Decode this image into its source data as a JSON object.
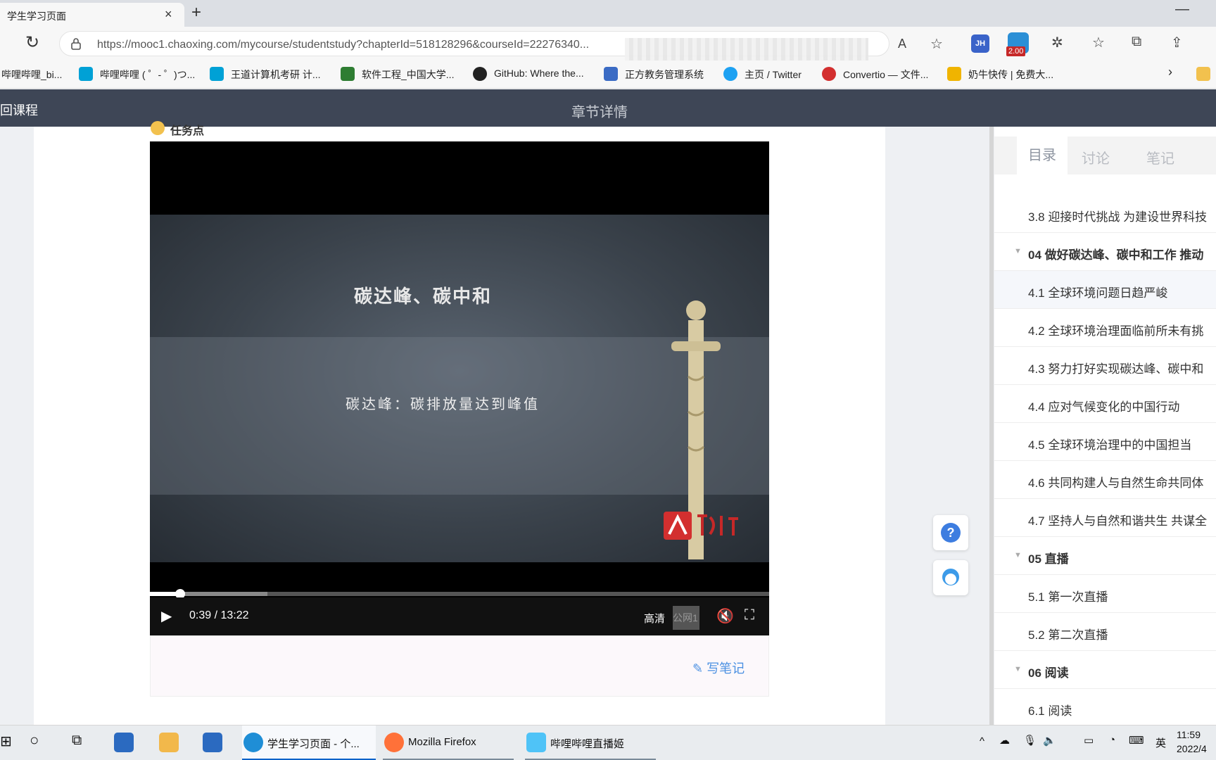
{
  "browser": {
    "tab_title": "学生学习页面",
    "tab_close": "×",
    "new_tab": "+",
    "minimize": "—",
    "url": "https://mooc1.chaoxing.com/mycourse/studentstudy?chapterId=518128296&courseId=22276340...",
    "speed_badge": "2.00",
    "ext_jh": "JH"
  },
  "bookmarks": [
    {
      "label": "哔哩哔哩_bi...",
      "color": "#ffffff"
    },
    {
      "label": "哔哩哔哩 ( ゜- ゜)つ...",
      "color": "#00a1d6"
    },
    {
      "label": "王道计算机考研 计...",
      "color": "#00a1d6"
    },
    {
      "label": "软件工程_中国大学...",
      "color": "#2e7d32"
    },
    {
      "label": "GitHub: Where the...",
      "color": "#222222"
    },
    {
      "label": "正方教务管理系统",
      "color": "#3b6bc4"
    },
    {
      "label": "主页 / Twitter",
      "color": "#1da1f2"
    },
    {
      "label": "Convertio — 文件...",
      "color": "#d32f2f"
    },
    {
      "label": "奶牛快传 | 免费大...",
      "color": "#f0b400"
    }
  ],
  "header": {
    "back_label": "回课程",
    "title": "章节详情"
  },
  "task_point_label": "任务点",
  "video": {
    "slide_title": "碳达峰、碳中和",
    "slide_subtitle": "碳达峰：碳排放量达到峰值",
    "time": "0:39  /  13:22",
    "quality": "高清",
    "line": "公网1",
    "played_fraction": 0.049,
    "buffered_fraction": 0.19
  },
  "note_button": "写笔记",
  "side": {
    "tabs": [
      "目录",
      "讨论",
      "笔记"
    ],
    "toc": [
      {
        "label": "3.8 迎接时代挑战 为建设世界科技",
        "type": "item"
      },
      {
        "label": "04 做好碳达峰、碳中和工作 推动",
        "type": "chapter"
      },
      {
        "label": "4.1 全球环境问题日趋严峻",
        "type": "current"
      },
      {
        "label": "4.2 全球环境治理面临前所未有挑",
        "type": "item"
      },
      {
        "label": "4.3 努力打好实现碳达峰、碳中和",
        "type": "item"
      },
      {
        "label": "4.4 应对气候变化的中国行动",
        "type": "item"
      },
      {
        "label": "4.5 全球环境治理中的中国担当",
        "type": "item"
      },
      {
        "label": "4.6 共同构建人与自然生命共同体",
        "type": "item"
      },
      {
        "label": "4.7 坚持人与自然和谐共生 共谋全",
        "type": "item"
      },
      {
        "label": "05 直播",
        "type": "chapter"
      },
      {
        "label": "5.1 第一次直播",
        "type": "item"
      },
      {
        "label": "5.2 第二次直播",
        "type": "item"
      },
      {
        "label": "06 阅读",
        "type": "chapter"
      },
      {
        "label": "6.1 阅读",
        "type": "item"
      }
    ]
  },
  "taskbar": {
    "apps": [
      {
        "label": "学生学习页面 - 个...",
        "color": "#1f8ed6"
      },
      {
        "label": "Mozilla Firefox",
        "color": "#ff7139"
      },
      {
        "label": "哔哩哔哩直播姬",
        "color": "#4fc3f7"
      }
    ],
    "ime": "英",
    "time": "11:59",
    "date": "2022/4"
  }
}
